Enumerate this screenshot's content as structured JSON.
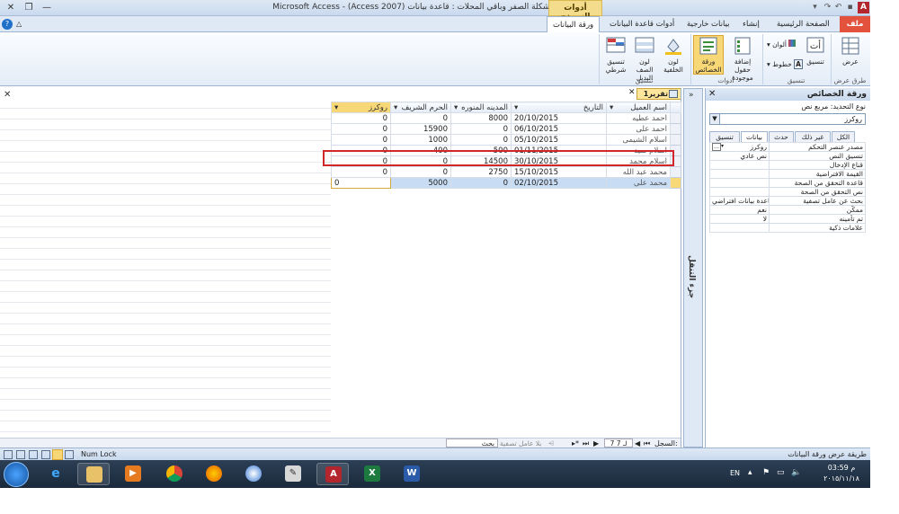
{
  "window": {
    "title": "Microsoft Access - (Access 2007) مشكلة الصفر وباقي المحلات : قاعدة بيانات",
    "context_group": "أدوات النموذج"
  },
  "tabs": {
    "file": "ملف",
    "home": "الصفحة الرئيسية",
    "create": "إنشاء",
    "external": "بيانات خارجية",
    "dbtools": "أدوات قاعدة البيانات",
    "datasheet": "ورقة البيانات"
  },
  "ribbon": {
    "views": {
      "label": "عرض",
      "group": "طرق عرض"
    },
    "format": {
      "group": "تنسيق",
      "colors": "ألوان",
      "fonts": "خطوط",
      "format_btn": "تنسيق"
    },
    "tools": {
      "group": "أدوات",
      "add_fields": "إضافة حقول موجودة",
      "property_sheet": "ورقة الخصائص"
    },
    "formatting": {
      "group": "تنسيق",
      "bg_color": "لون الخلفية",
      "alt_row": "لون الصف البديل",
      "cond_format": "تنسيق شرطي"
    }
  },
  "datasheet": {
    "tab_label": "تقرير1",
    "columns": [
      "اسم العميل",
      "التاريخ",
      "المدينه المنوره",
      "الحرم الشريف",
      "روكرز"
    ],
    "rows": [
      {
        "name": "احمد عطيه",
        "date": "20/10/2015",
        "madina": "8000",
        "haram": "0",
        "rockers": "0"
      },
      {
        "name": "احمد على",
        "date": "06/10/2015",
        "madina": "0",
        "haram": "15900",
        "rockers": "0"
      },
      {
        "name": "اسلام الشيمى",
        "date": "05/10/2015",
        "madina": "0",
        "haram": "1000",
        "rockers": "0"
      },
      {
        "name": "اسلام سيد",
        "date": "01/11/2015",
        "madina": "500",
        "haram": "400",
        "rockers": "0"
      },
      {
        "name": "اسلام محمد",
        "date": "30/10/2015",
        "madina": "14500",
        "haram": "0",
        "rockers": "0"
      },
      {
        "name": "محمد عبد الله",
        "date": "15/10/2015",
        "madina": "2750",
        "haram": "0",
        "rockers": "0"
      },
      {
        "name": "محمد على",
        "date": "02/10/2015",
        "madina": "0",
        "haram": "5000",
        "rockers": "0"
      }
    ]
  },
  "navpane": {
    "label": "جزء التنقل"
  },
  "properties": {
    "title": "ورقة الخصائص",
    "selection_type": "نوع التحديد: مربع نص",
    "selected": "روكرز",
    "tabs": [
      "تنسيق",
      "بيانات",
      "حدث",
      "غير ذلك",
      "الكل"
    ],
    "rows": [
      {
        "name": "مصدر عنصر التحكم",
        "value": "روكرز"
      },
      {
        "name": "تنسيق النص",
        "value": "نص عادي"
      },
      {
        "name": "قناع الإدخال",
        "value": ""
      },
      {
        "name": "القيمة الافتراضية",
        "value": ""
      },
      {
        "name": "قاعدة التحقق من الصحة",
        "value": ""
      },
      {
        "name": "نص التحقق من الصحة",
        "value": ""
      },
      {
        "name": "بحث عن عامل تصفية",
        "value": "قاعدة بيانات افتراضي"
      },
      {
        "name": "ممكّن",
        "value": "نعم"
      },
      {
        "name": "تم تأمينه",
        "value": "لا"
      },
      {
        "name": "علامات ذكية",
        "value": ""
      }
    ]
  },
  "recnav": {
    "label": "السجل:",
    "position": "7 لـ 7",
    "filter": "بلا عامل تصفية",
    "search": "بحث"
  },
  "status": {
    "left": "طريقة عرض ورقة البيانات",
    "numlock": "Num Lock"
  },
  "tray": {
    "lang": "EN",
    "time": "03:59 م",
    "date": "٢٠١٥/١١/١٨"
  },
  "colors": {
    "accent": "#f8d776",
    "highlight": "#d2262b",
    "file_tab": "#e2523c"
  }
}
